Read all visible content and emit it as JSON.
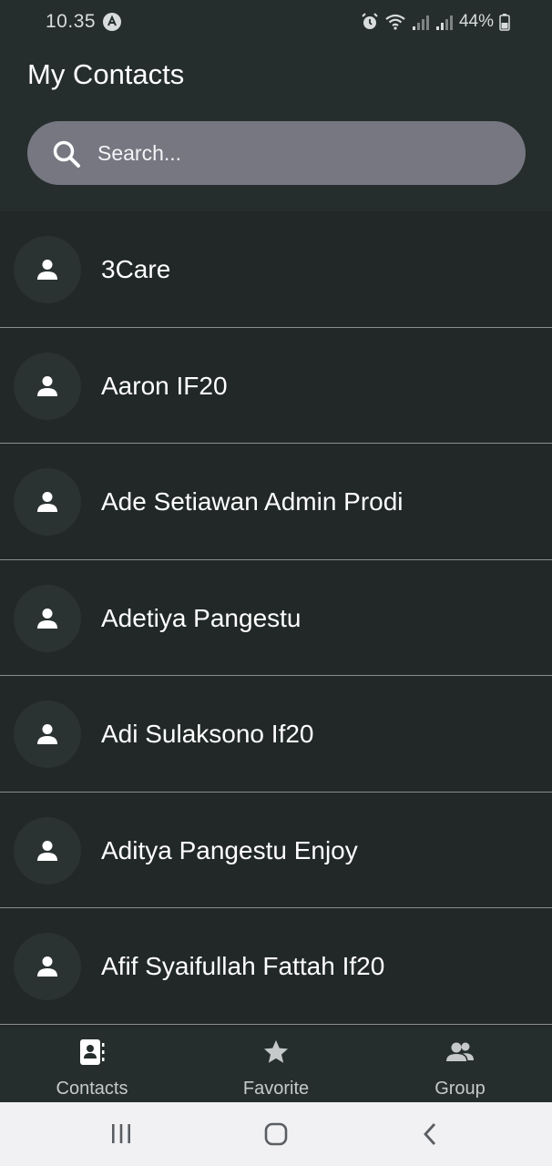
{
  "status_bar": {
    "time": "10.35",
    "battery": "44%",
    "icons": [
      "alarm-icon",
      "wifi-icon",
      "signal-icon",
      "signal-icon",
      "battery-icon"
    ]
  },
  "header": {
    "title": "My Contacts",
    "search": {
      "placeholder": "Search...",
      "value": ""
    }
  },
  "contacts": [
    {
      "name": "3Care"
    },
    {
      "name": "Aaron IF20"
    },
    {
      "name": "Ade Setiawan Admin Prodi"
    },
    {
      "name": "Adetiya Pangestu"
    },
    {
      "name": "Adi Sulaksono If20"
    },
    {
      "name": "Aditya Pangestu Enjoy"
    },
    {
      "name": "Afif Syaifullah Fattah If20"
    }
  ],
  "bottom_nav": {
    "items": [
      {
        "label": "Contacts",
        "icon": "contacts-icon"
      },
      {
        "label": "Favorite",
        "icon": "star-icon"
      },
      {
        "label": "Group",
        "icon": "group-icon"
      }
    ]
  },
  "system_nav": {
    "buttons": [
      "recents",
      "home",
      "back"
    ]
  },
  "colors": {
    "background": "#212827",
    "header": "#252e2d",
    "search_bg": "#767781",
    "avatar_bg": "#2b3332",
    "divider": "#8a8f8e"
  }
}
